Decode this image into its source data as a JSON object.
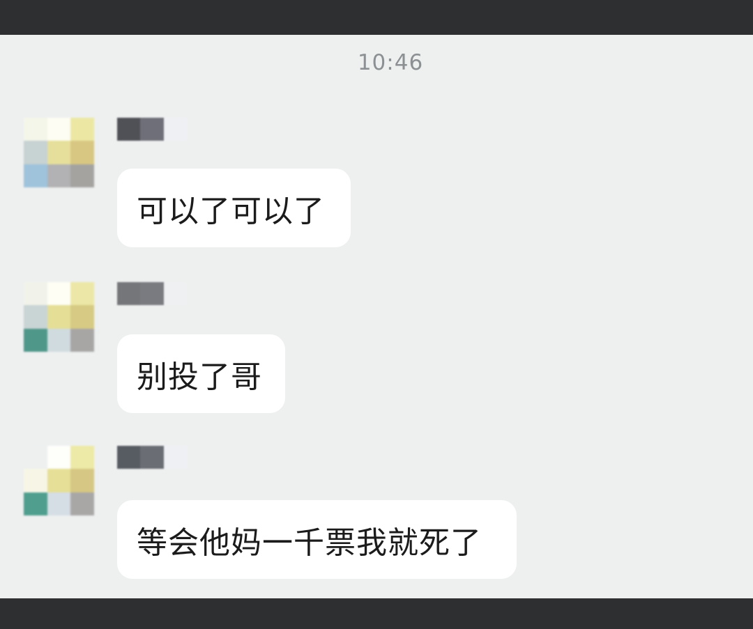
{
  "chat": {
    "timestamp": "10:46",
    "messages": [
      {
        "text": "可以了可以了",
        "avatar_colors": [
          "#f4f6e9",
          "#fdfdf3",
          "#ece8a4",
          "#c7d2d2",
          "#e6df9b",
          "#d8c783",
          "#9ec3db",
          "#b2b1b3",
          "#a4a3a0"
        ],
        "name_colors": [
          "#4f5157",
          "#6e6f78",
          "#eef0f4"
        ]
      },
      {
        "text": "别投了哥",
        "avatar_colors": [
          "#f1f3ea",
          "#fefef5",
          "#ece7a6",
          "#c9d4d4",
          "#e5de96",
          "#d6ca84",
          "#4f9789",
          "#d0dbdf",
          "#a8a6a5"
        ],
        "name_colors": [
          "#75767a",
          "#7a7b80",
          "#eff0f1"
        ]
      },
      {
        "text": "等会他妈一千票我就死了",
        "avatar_colors": [
          "#edf0ef",
          "#fefefb",
          "#ede9a6",
          "#f7f6e6",
          "#e5df97",
          "#d6c784",
          "#4f9e8e",
          "#d5dde5",
          "#a9a7a6"
        ],
        "name_colors": [
          "#575b62",
          "#6a6e74",
          "#eef0f4"
        ]
      }
    ]
  }
}
